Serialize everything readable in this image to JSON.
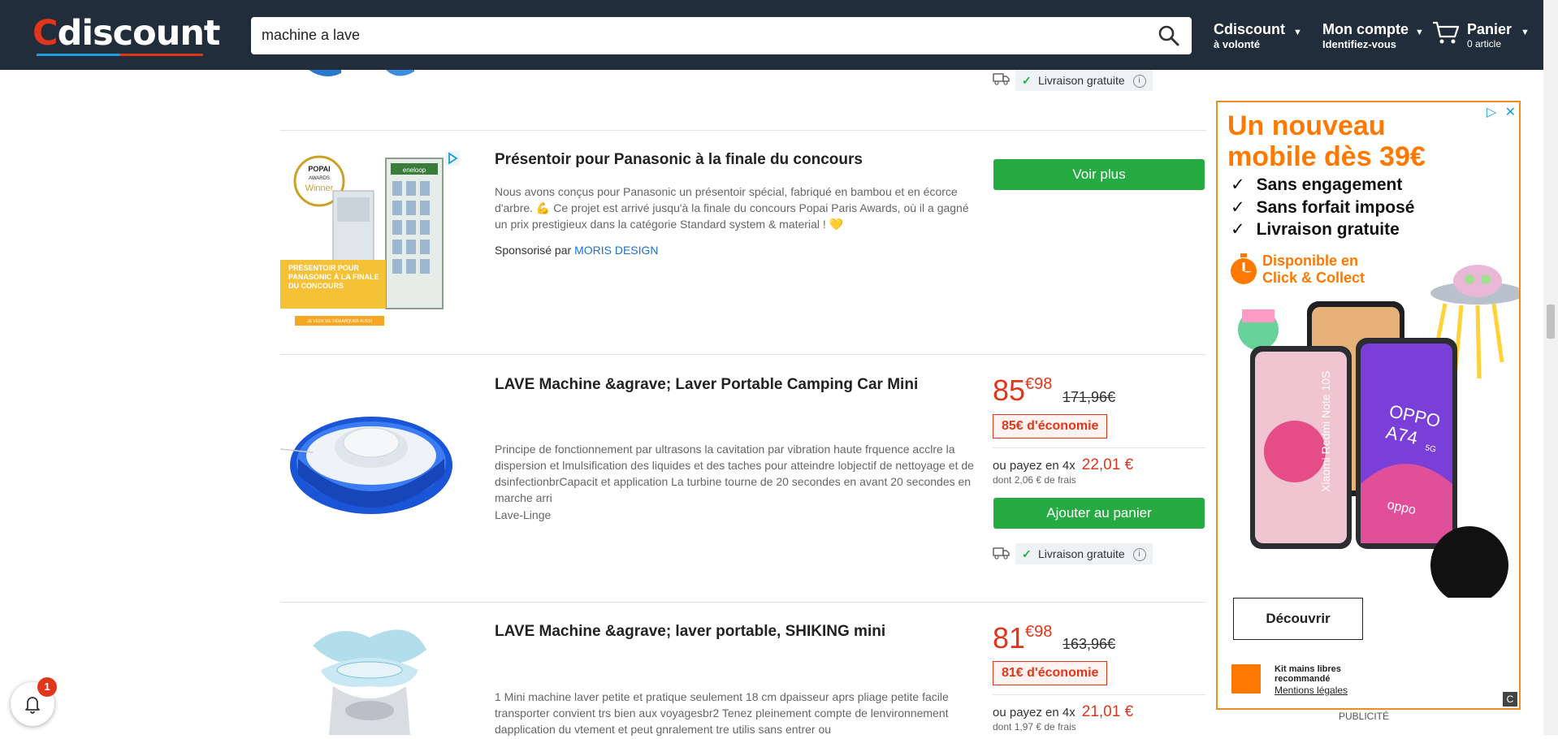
{
  "header": {
    "logo": {
      "c": "C",
      "rest": "discount"
    },
    "search_value": "machine a lave",
    "cdiscount_volonte": {
      "title": "Cdiscount",
      "subtitle": "à volonté"
    },
    "account": {
      "title": "Mon compte",
      "subtitle": "Identifiez-vous"
    },
    "cart": {
      "title": "Panier",
      "subtitle": "0 article"
    }
  },
  "top_item": {
    "delivery": "Livraison gratuite"
  },
  "sponsored": {
    "title": "Présentoir pour Panasonic à la finale du concours",
    "description": "Nous avons conçus pour Panasonic un présentoir spécial, fabriqué en bambou et en écorce d'arbre. 💪 Ce projet est arrivé jusqu'à la finale du concours Popai Paris Awards, où il a gagné un prix prestigieux dans la catégorie Standard system & material ! 💛",
    "sponsored_by": "Sponsorisé par",
    "brand": "MORIS DESIGN",
    "button": "Voir plus",
    "image_text": {
      "badge_top": "POPAI",
      "badge_mid": "AWARDS",
      "badge_winner": "Winner",
      "label": "PRÉSENTOIR POUR PANASONIC À LA FINALE DU CONCOURS",
      "cta": "JE VEUX ME DÉMARQUER AUSSI",
      "brand_tag": "eneloop"
    }
  },
  "products": [
    {
      "title": "LAVE Machine &agrave; Laver Portable Camping Car Mini",
      "description": "Principe de fonctionnement par ultrasons la cavitation par vibration haute frquence acclre la dispersion et lmulsification des liquides et des taches pour atteindre lobjectif de nettoyage et de dsinfectionbrCapacit et application La turbine tourne de 20 secondes en avant 20 secondes en marche arri",
      "category": "Lave-Linge",
      "price_int": "85",
      "price_dec": "€98",
      "old_price": "171,96€",
      "economy": "85€ d'économie",
      "pay_prefix": "ou payez en 4x",
      "pay_amount": "22,01 €",
      "fees": "dont 2,06 € de frais",
      "button": "Ajouter au panier",
      "delivery": "Livraison gratuite"
    },
    {
      "title": "LAVE Machine &agrave; laver portable, SHIKING mini",
      "description": "1 Mini machine laver petite et pratique seulement 18 cm dpaisseur aprs pliage petite facile transporter convient trs bien aux voyagesbr2 Tenez pleinement compte de lenvironnement dapplication du vtement et peut gnralement tre utilis sans entrer ou",
      "price_int": "81",
      "price_dec": "€98",
      "old_price": "163,96€",
      "economy": "81€ d'économie",
      "pay_prefix": "ou payez en 4x",
      "pay_amount": "21,01 €",
      "fees": "dont 1,97 € de frais"
    }
  ],
  "ad": {
    "headline_1": "Un nouveau",
    "headline_2": "mobile dès 39€",
    "bullets": [
      "Sans engagement",
      "Sans forfait imposé",
      "Livraison gratuite"
    ],
    "click_collect_1": "Disponible en",
    "click_collect_2": "Click & Collect",
    "phone_left": "Xiaomi Redmi Note 10S",
    "phone_right_1": "OPPO",
    "phone_right_2": "A74",
    "phone_right_badge": "5G",
    "phone_right_brand": "oppo",
    "discover": "Découvrir",
    "kit_1": "Kit mains libres",
    "kit_2": "recommandé",
    "legal": "Mentions légales",
    "label": "PUBLICITÉ"
  },
  "notifications": {
    "count": "1"
  },
  "colors": {
    "header_bg": "#212d3b",
    "accent_red": "#e2361c",
    "green": "#26ab43",
    "orange": "#ff7900"
  }
}
